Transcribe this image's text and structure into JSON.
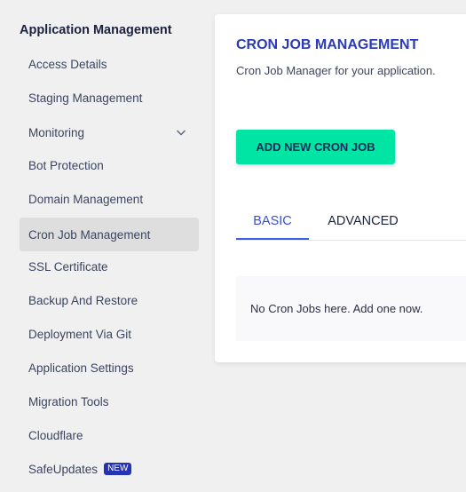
{
  "sidebar": {
    "title": "Application Management",
    "items": [
      {
        "label": "Access Details"
      },
      {
        "label": "Staging Management"
      },
      {
        "label": "Monitoring",
        "has_submenu": true
      },
      {
        "label": "Bot Protection"
      },
      {
        "label": "Domain Management"
      },
      {
        "label": "Cron Job Management",
        "active": true
      },
      {
        "label": "SSL Certificate"
      },
      {
        "label": "Backup And Restore"
      },
      {
        "label": "Deployment Via Git"
      },
      {
        "label": "Application Settings"
      },
      {
        "label": "Migration Tools"
      },
      {
        "label": "Cloudflare"
      },
      {
        "label": "SafeUpdates",
        "badge": "NEW"
      }
    ]
  },
  "main": {
    "title": "CRON JOB MANAGEMENT",
    "subtitle": "Cron Job Manager for your application.",
    "add_button": "ADD NEW CRON JOB",
    "tabs": [
      {
        "label": "BASIC",
        "active": true
      },
      {
        "label": "ADVANCED"
      }
    ],
    "empty_message": "No Cron Jobs here. Add one now."
  },
  "colors": {
    "accent": "#2b3bb5",
    "button": "#00e4a4",
    "tab_active": "#3a5ee8",
    "badge": "#2433b6"
  }
}
